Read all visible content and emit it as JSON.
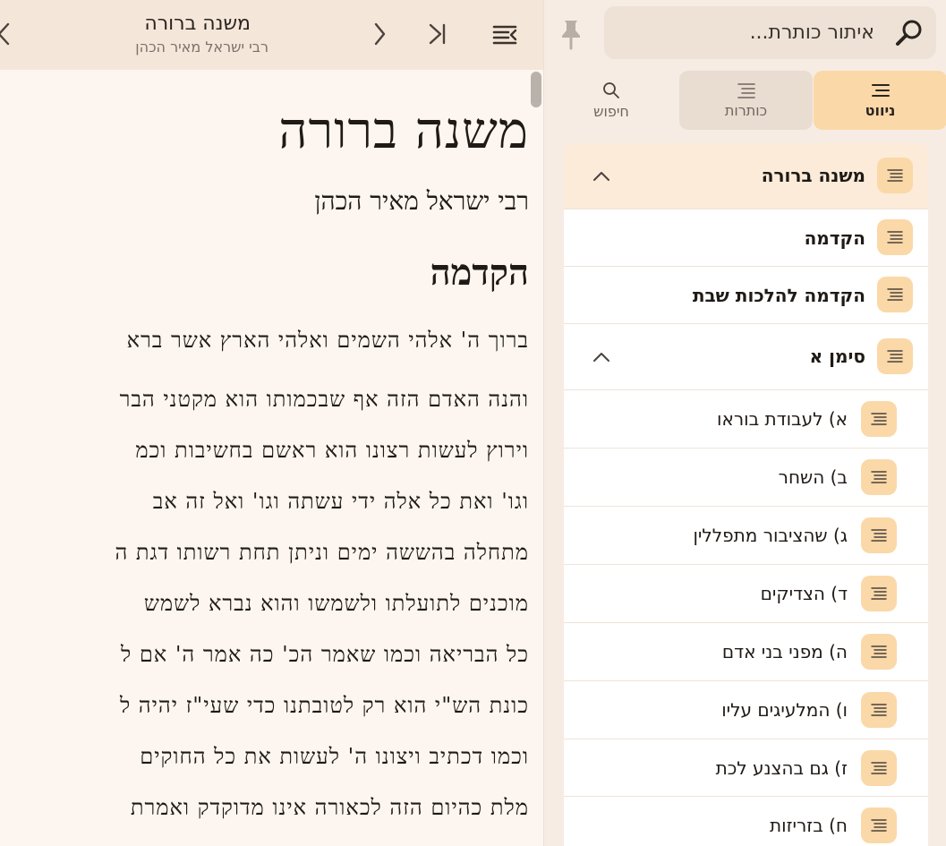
{
  "reader": {
    "header_title": "משנה ברורה",
    "header_subtitle": "רבי ישראל מאיר הכהן",
    "book_title": "משנה ברורה",
    "author": "רבי ישראל מאיר הכהן",
    "section_title": "הקדמה",
    "lines": [
      "ברוך ה' אלהי השמים ואלהי הארץ אשר ברא",
      "והנה האדם הזה אף שבכמותו הוא מקטני הבר",
      "וירוץ לעשות רצונו הוא ראשם בחשיבות וכמ",
      "וגו' ואת כל אלה ידי עשתה וגו' ואל זה אב",
      "מתחלה בהששה ימים וניתן תחת רשותו דגת ה",
      "מוכנים לתועלתו ולשמשו והוא נברא לשמש",
      "כל הבריאה וכמו שאמר הכ' כה אמר ה' אם ל",
      "כונת הש\"י הוא רק לטובתנו כדי שעי\"ז יהיה ל",
      "וכמו דכתיב ויצונו ה' לעשות את כל החוקים",
      "מלת כהיום הזה לכאורה אינו מדוקדק ואמרת"
    ]
  },
  "sidebar": {
    "search_placeholder": "איתור כותרת...",
    "tabs": {
      "navigation": "ניווט",
      "headings": "כותרות",
      "search": "חיפוש"
    },
    "tree": [
      {
        "label": "משנה ברורה",
        "bold": true,
        "expanded": true,
        "level": 0
      },
      {
        "label": "הקדמה",
        "bold": true,
        "expanded": false,
        "level": 0
      },
      {
        "label": "הקדמה להלכות שבת",
        "bold": true,
        "expanded": false,
        "level": 0
      },
      {
        "label": "סימן א",
        "bold": true,
        "expanded": true,
        "level": 0
      },
      {
        "label": "א) לעבודת בוראו",
        "bold": false,
        "level": 1
      },
      {
        "label": "ב) השחר",
        "bold": false,
        "level": 1
      },
      {
        "label": "ג) שהציבור מתפללין",
        "bold": false,
        "level": 1
      },
      {
        "label": "ד) הצדיקים",
        "bold": false,
        "level": 1
      },
      {
        "label": "ה) מפני בני אדם",
        "bold": false,
        "level": 1
      },
      {
        "label": "ו) המלעיגים עליו",
        "bold": false,
        "level": 1
      },
      {
        "label": "ז) גם בהצנע לכת",
        "bold": false,
        "level": 1
      },
      {
        "label": "ח) בזריזות",
        "bold": false,
        "level": 1
      }
    ]
  },
  "colors": {
    "accent": "#fbd8a8",
    "header_bg": "#f4e6d9",
    "page_bg": "#fdf6f0"
  }
}
